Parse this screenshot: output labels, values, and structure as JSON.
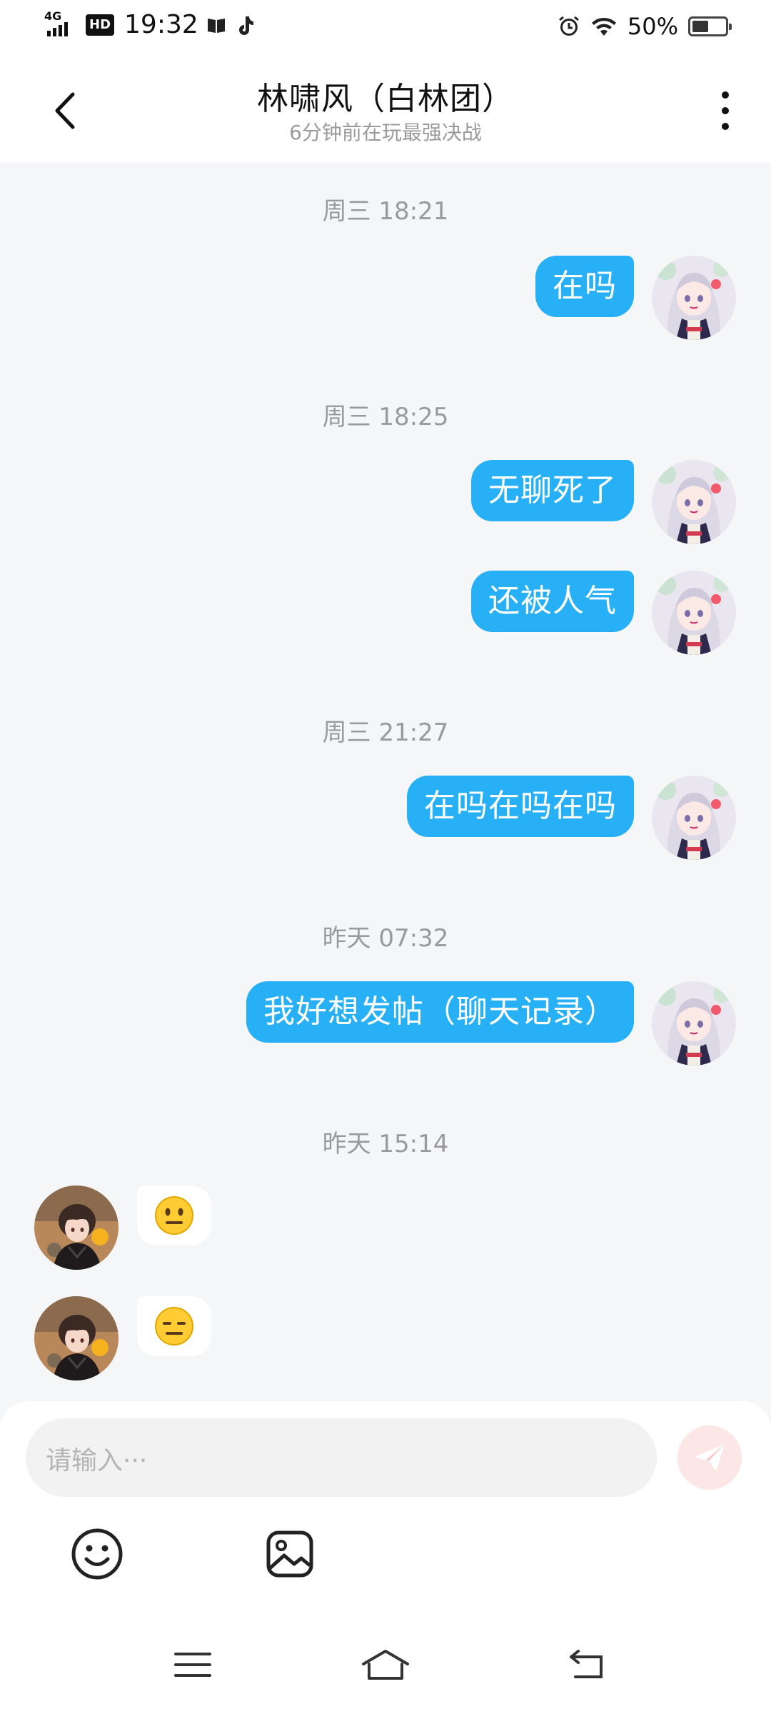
{
  "status_bar": {
    "network": "4G",
    "hd": "HD",
    "time": "19:32",
    "battery": "50%",
    "battery_level": 0.5,
    "icons": [
      "signal-icon",
      "book-icon",
      "tiktok-icon",
      "alarm-icon",
      "wifi-icon",
      "battery-icon"
    ]
  },
  "header": {
    "title": "林啸风（白林团）",
    "subtitle": "6分钟前在玩最强决战"
  },
  "messages": [
    {
      "type": "timestamp",
      "text": "周三  18:21"
    },
    {
      "type": "outgoing",
      "text": "在吗"
    },
    {
      "type": "timestamp",
      "text": "周三  18:25"
    },
    {
      "type": "outgoing",
      "text": "无聊死了"
    },
    {
      "type": "outgoing",
      "text": "还被人气"
    },
    {
      "type": "timestamp",
      "text": "周三  21:27"
    },
    {
      "type": "outgoing",
      "text": "在吗在吗在吗"
    },
    {
      "type": "timestamp",
      "text": "昨天  07:32"
    },
    {
      "type": "outgoing",
      "text": "我好想发帖（聊天记录）"
    },
    {
      "type": "timestamp",
      "text": "昨天  15:14"
    },
    {
      "type": "incoming",
      "emoji": "neutral-face"
    },
    {
      "type": "incoming",
      "emoji": "expressionless-face"
    }
  ],
  "composer": {
    "placeholder": "请输入···"
  },
  "colors": {
    "outgoing_bubble": "#27b0f5",
    "background": "#f5f6f8",
    "send_button": "#fde6e6"
  }
}
